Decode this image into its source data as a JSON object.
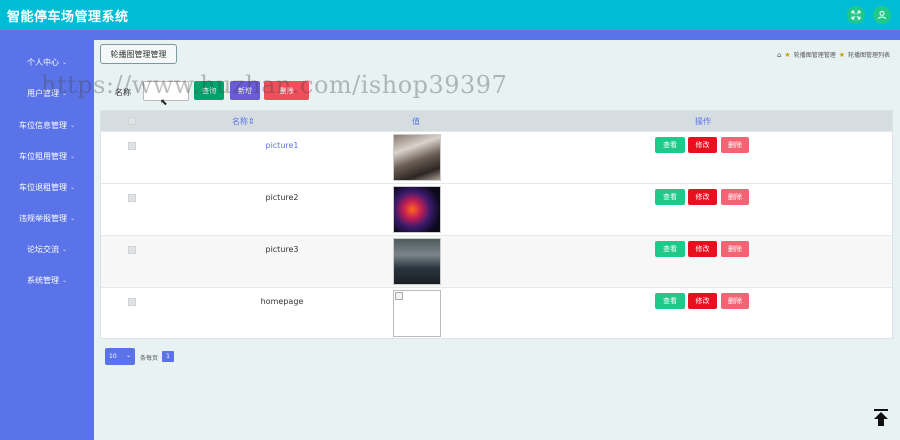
{
  "app": {
    "title": "智能停车场管理系统"
  },
  "header": {
    "expand_icon": "expand-icon",
    "user_icon": "user-icon"
  },
  "sidebar": {
    "items": [
      {
        "label": "个人中心",
        "chevron": "⌄"
      },
      {
        "label": "用户管理",
        "chevron": "⌄"
      },
      {
        "label": "车位信息管理",
        "chevron": "⌄"
      },
      {
        "label": "车位租用管理",
        "chevron": "⌄"
      },
      {
        "label": "车位退租管理",
        "chevron": "⌄"
      },
      {
        "label": "违规举报管理",
        "chevron": "⌄"
      },
      {
        "label": "论坛交流",
        "chevron": "⌄"
      },
      {
        "label": "系统管理",
        "chevron": "⌄"
      }
    ]
  },
  "page": {
    "tab_label": "轮播图管理管理",
    "breadcrumb": [
      "轮播图管理管理",
      "轮播图管理列表"
    ]
  },
  "search": {
    "label": "名称",
    "value": "",
    "placeholder": "",
    "query_label": "查询",
    "add_label": "新增",
    "delete_label": "删除"
  },
  "watermark": "https://www.huzhan.com/ishop39397",
  "table": {
    "columns": {
      "name": "名称",
      "value": "值",
      "actions": "操作"
    },
    "sort_indicator": "⇕",
    "rows": [
      {
        "name": "picture1",
        "image": "p1"
      },
      {
        "name": "picture2",
        "image": "p2"
      },
      {
        "name": "picture3",
        "image": "p3"
      },
      {
        "name": "homepage",
        "image": "broken"
      }
    ],
    "action_labels": {
      "view": "查看",
      "edit": "修改",
      "delete": "删除"
    }
  },
  "pagination": {
    "page_size": "10",
    "per_page_label": "条每页",
    "current_page": "1"
  }
}
